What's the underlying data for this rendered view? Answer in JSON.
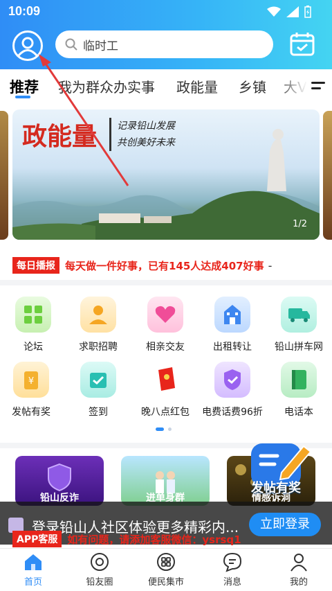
{
  "status_bar": {
    "time": "10:09"
  },
  "search": {
    "placeholder": "临时工"
  },
  "tabs": [
    {
      "label": "推荐"
    },
    {
      "label": "我为群众办实事"
    },
    {
      "label": "政能量"
    },
    {
      "label": "乡镇"
    },
    {
      "label": "大V"
    }
  ],
  "banner": {
    "title": "政能量",
    "slogan_line1": "记录铅山发展",
    "slogan_line2": "共创美好未来",
    "pager": "1/2"
  },
  "announcement": {
    "tag": "每日播报",
    "message": "每天做一件好事，已有145人达成407好事",
    "trail": "-"
  },
  "grid": [
    {
      "label": "论坛",
      "color": "#7ed957"
    },
    {
      "label": "求职招聘",
      "color": "#f7b33b"
    },
    {
      "label": "相亲交友",
      "color": "#f25fa3"
    },
    {
      "label": "出租转让",
      "color": "#3e8ef7"
    },
    {
      "label": "铅山拼车网",
      "color": "#2fc1a9"
    },
    {
      "label": "发帖有奖",
      "color": "#f5b43a"
    },
    {
      "label": "签到",
      "color": "#30c5b8"
    },
    {
      "label": "晚八点红包",
      "color": "#e8251b"
    },
    {
      "label": "电费话费96折",
      "color": "#9d6af2"
    },
    {
      "label": "电话本",
      "color": "#3bb769"
    }
  ],
  "cards": [
    {
      "label": "铅山反诈"
    },
    {
      "label": "进单身群"
    },
    {
      "label": "情感诉洞"
    }
  ],
  "fab": {
    "label": "发帖有奖"
  },
  "login_bar": {
    "text": "登录铅山人社区体验更多精彩内...",
    "button": "立即登录"
  },
  "service": {
    "tag": "APP客服",
    "message": "如有问题，请添加客服微信：ysrsq1"
  },
  "nav": [
    {
      "label": "首页",
      "icon": "home-icon"
    },
    {
      "label": "铅友圈",
      "icon": "circle-icon"
    },
    {
      "label": "便民集市",
      "icon": "market-icon"
    },
    {
      "label": "消息",
      "icon": "message-icon"
    },
    {
      "label": "我的",
      "icon": "profile-icon"
    }
  ],
  "colors": {
    "accent": "#2f8df6",
    "alert": "#e8251b"
  }
}
